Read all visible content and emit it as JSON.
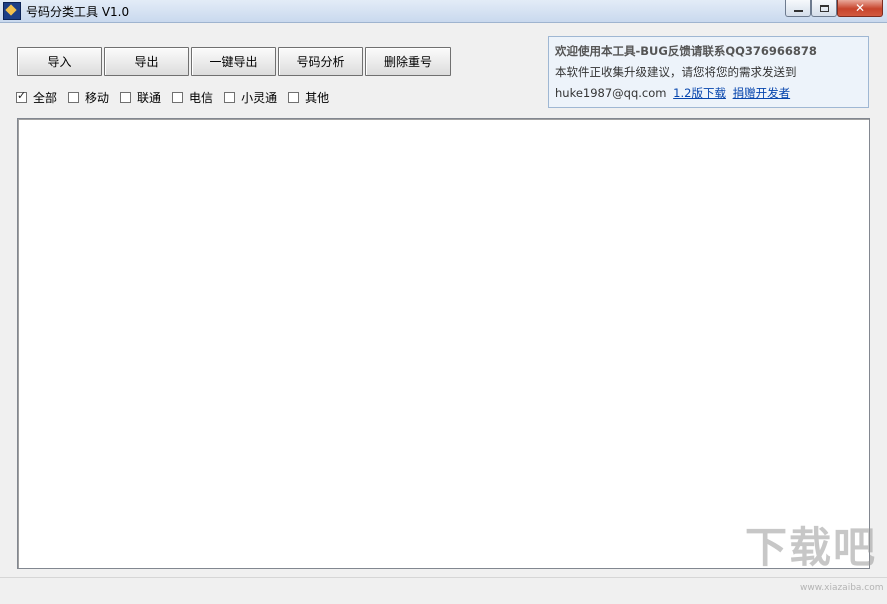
{
  "window": {
    "title": "号码分类工具 V1.0",
    "close_glyph": "✕"
  },
  "toolbar": {
    "import_label": "导入",
    "export_label": "导出",
    "one_click_export_label": "一键导出",
    "analyze_label": "号码分析",
    "dedupe_label": "删除重号"
  },
  "filters": [
    {
      "label": "全部",
      "checked": true
    },
    {
      "label": "移动",
      "checked": false
    },
    {
      "label": "联通",
      "checked": false
    },
    {
      "label": "电信",
      "checked": false
    },
    {
      "label": "小灵通",
      "checked": false
    },
    {
      "label": "其他",
      "checked": false
    }
  ],
  "info": {
    "line1": "欢迎使用本工具-BUG反馈请联系QQ376966878",
    "line2": "本软件正收集升级建议，请您将您的需求发送到",
    "email": "huke1987@qq.com",
    "download_link": "1.2版下载",
    "donate_link": "捐赠开发者"
  },
  "output": {
    "content": ""
  },
  "watermark": {
    "text": "下载吧",
    "sub": "www.xiazaiba.com"
  },
  "colors": {
    "info_bg": "#edf3fa",
    "info_border": "#9fb7d3",
    "link": "#0645ad",
    "close_button": "#c7442c"
  }
}
